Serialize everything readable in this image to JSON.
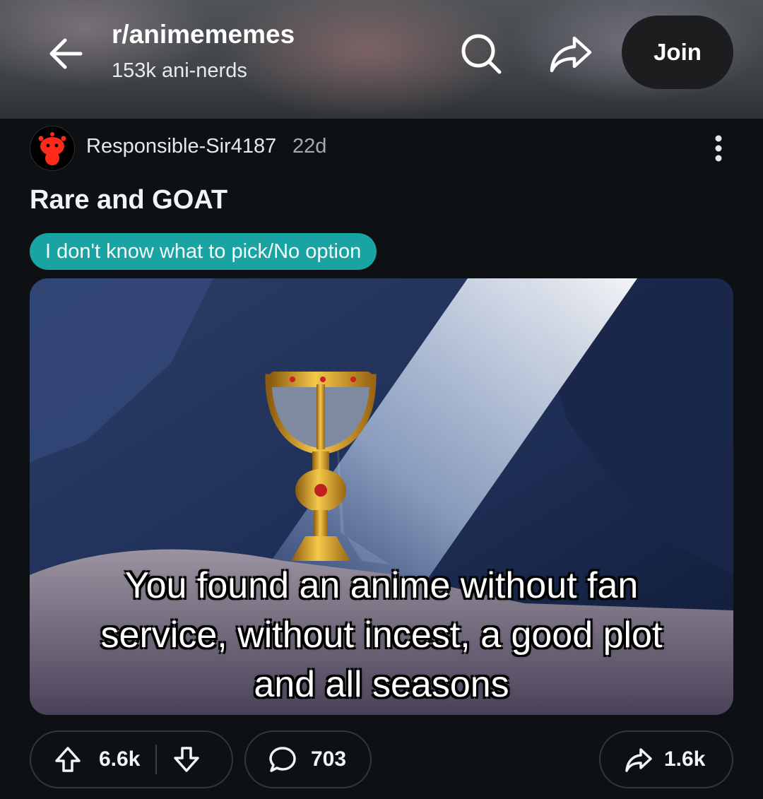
{
  "header": {
    "subreddit": "r/animememes",
    "members": "153k ani-nerds",
    "join_label": "Join",
    "icons": [
      "back-arrow-icon",
      "search-icon",
      "share-icon"
    ]
  },
  "post": {
    "author": "Responsible-Sir4187",
    "age": "22d",
    "title": "Rare and GOAT",
    "flair": "I don't know what to pick/No option",
    "image_caption": {
      "line1": "You found an anime without fan",
      "line2": "service, without incest, a good plot",
      "line3": "and all seasons"
    }
  },
  "actions": {
    "upvotes": "6.6k",
    "comments": "703",
    "shares": "1.6k"
  },
  "colors": {
    "background": "#0e1113",
    "flair": "#1aa3a3",
    "join_bg": "#1b1d1f",
    "avatar_accent": "#ff2a1a"
  }
}
